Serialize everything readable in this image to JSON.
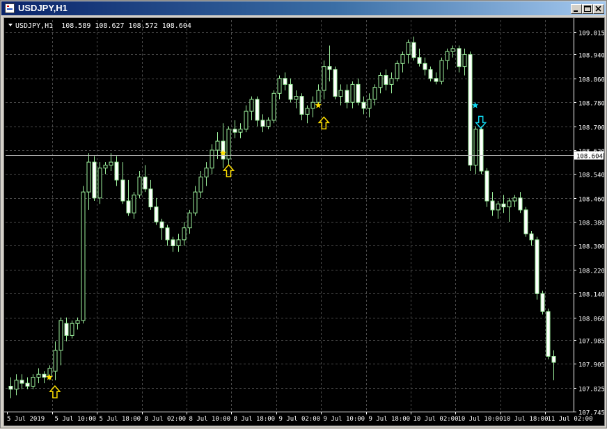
{
  "window": {
    "title": "USDJPY,H1",
    "controls": [
      "minimize",
      "maximize",
      "close"
    ]
  },
  "chart_header": {
    "symbol_period": "USDJPY,H1",
    "ohlc": "108.589 108.627 108.572 108.604"
  },
  "colors": {
    "background": "#000000",
    "grid": "#4a4a4a",
    "candle": "#9cf09c",
    "up_body": "#000000",
    "down_body": "#ffffff",
    "text": "#ffffff",
    "buy_signal": "#ffe000",
    "sell_signal": "#10d8f0",
    "price_line": "#c0c0c0"
  },
  "chart_data": {
    "type": "candlestick",
    "symbol": "USDJPY",
    "timeframe": "H1",
    "ylim": [
      107.745,
      109.055
    ],
    "y_ticks": [
      "109.015",
      "108.940",
      "108.860",
      "108.780",
      "108.700",
      "108.620",
      "108.540",
      "108.460",
      "108.380",
      "108.300",
      "108.220",
      "108.140",
      "108.060",
      "107.985",
      "107.905",
      "107.825",
      "107.745"
    ],
    "x_ticks": [
      "5 Jul 2019",
      "5 Jul 10:00",
      "5 Jul 18:00",
      "8 Jul 02:00",
      "8 Jul 10:00",
      "8 Jul 18:00",
      "9 Jul 02:00",
      "9 Jul 10:00",
      "9 Jul 18:00",
      "10 Jul 02:00",
      "10 Jul 10:00",
      "10 Jul 18:00",
      "11 Jul 02:00"
    ],
    "x_tick_slots": [
      0,
      8,
      16,
      24,
      32,
      40,
      48,
      56,
      64,
      72,
      80,
      88,
      96
    ],
    "current_price": "108.604",
    "grid": true,
    "candles": [
      [
        107.83,
        107.86,
        107.79,
        107.82
      ],
      [
        107.82,
        107.87,
        107.8,
        107.85
      ],
      [
        107.85,
        107.87,
        107.82,
        107.84
      ],
      [
        107.84,
        107.86,
        107.82,
        107.83
      ],
      [
        107.83,
        107.87,
        107.82,
        107.86
      ],
      [
        107.86,
        107.89,
        107.84,
        107.87
      ],
      [
        107.87,
        107.88,
        107.84,
        107.86
      ],
      [
        107.86,
        107.9,
        107.85,
        107.89
      ],
      [
        107.88,
        107.98,
        107.85,
        107.95
      ],
      [
        107.95,
        108.06,
        107.9,
        108.05
      ],
      [
        108.04,
        108.06,
        107.98,
        108.0
      ],
      [
        108.0,
        108.05,
        107.99,
        108.04
      ],
      [
        108.04,
        108.06,
        108.02,
        108.05
      ],
      [
        108.05,
        108.5,
        108.04,
        108.48
      ],
      [
        108.48,
        108.61,
        108.42,
        108.58
      ],
      [
        108.58,
        108.6,
        108.45,
        108.46
      ],
      [
        108.46,
        108.58,
        108.44,
        108.56
      ],
      [
        108.56,
        108.58,
        108.54,
        108.57
      ],
      [
        108.57,
        108.61,
        108.55,
        108.58
      ],
      [
        108.58,
        108.6,
        108.5,
        108.52
      ],
      [
        108.52,
        108.58,
        108.44,
        108.45
      ],
      [
        108.45,
        108.52,
        108.4,
        108.41
      ],
      [
        108.41,
        108.48,
        108.39,
        108.47
      ],
      [
        108.47,
        108.55,
        108.46,
        108.53
      ],
      [
        108.53,
        108.57,
        108.48,
        108.49
      ],
      [
        108.49,
        108.52,
        108.42,
        108.43
      ],
      [
        108.43,
        108.46,
        108.37,
        108.38
      ],
      [
        108.38,
        108.39,
        108.32,
        108.36
      ],
      [
        108.36,
        108.37,
        108.3,
        108.32
      ],
      [
        108.32,
        108.33,
        108.28,
        108.3
      ],
      [
        108.3,
        108.34,
        108.28,
        108.32
      ],
      [
        108.32,
        108.38,
        108.3,
        108.36
      ],
      [
        108.36,
        108.42,
        108.34,
        108.41
      ],
      [
        108.41,
        108.5,
        108.4,
        108.48
      ],
      [
        108.48,
        108.55,
        108.46,
        108.53
      ],
      [
        108.53,
        108.58,
        108.5,
        108.56
      ],
      [
        108.56,
        108.64,
        108.54,
        108.62
      ],
      [
        108.62,
        108.68,
        108.59,
        108.65
      ],
      [
        108.65,
        108.71,
        108.56,
        108.59
      ],
      [
        108.59,
        108.7,
        108.57,
        108.69
      ],
      [
        108.69,
        108.72,
        108.66,
        108.68
      ],
      [
        108.68,
        108.71,
        108.66,
        108.69
      ],
      [
        108.69,
        108.77,
        108.68,
        108.75
      ],
      [
        108.75,
        108.8,
        108.72,
        108.79
      ],
      [
        108.79,
        108.8,
        108.7,
        108.72
      ],
      [
        108.72,
        108.74,
        108.68,
        108.7
      ],
      [
        108.7,
        108.73,
        108.69,
        108.72
      ],
      [
        108.72,
        108.82,
        108.71,
        108.81
      ],
      [
        108.81,
        108.87,
        108.79,
        108.86
      ],
      [
        108.86,
        108.88,
        108.82,
        108.84
      ],
      [
        108.84,
        108.86,
        108.78,
        108.79
      ],
      [
        108.79,
        108.82,
        108.76,
        108.8
      ],
      [
        108.8,
        108.81,
        108.72,
        108.74
      ],
      [
        108.74,
        108.77,
        108.71,
        108.76
      ],
      [
        108.76,
        108.8,
        108.73,
        108.78
      ],
      [
        108.78,
        108.84,
        108.77,
        108.82
      ],
      [
        108.82,
        108.92,
        108.79,
        108.9
      ],
      [
        108.9,
        108.97,
        108.85,
        108.89
      ],
      [
        108.89,
        108.9,
        108.79,
        108.8
      ],
      [
        108.8,
        108.84,
        108.77,
        108.82
      ],
      [
        108.82,
        108.84,
        108.76,
        108.78
      ],
      [
        108.78,
        108.85,
        108.76,
        108.84
      ],
      [
        108.84,
        108.86,
        108.77,
        108.78
      ],
      [
        108.78,
        108.8,
        108.74,
        108.76
      ],
      [
        108.76,
        108.81,
        108.73,
        108.79
      ],
      [
        108.79,
        108.84,
        108.77,
        108.83
      ],
      [
        108.83,
        108.88,
        108.81,
        108.87
      ],
      [
        108.87,
        108.89,
        108.82,
        108.84
      ],
      [
        108.84,
        108.88,
        108.81,
        108.86
      ],
      [
        108.86,
        108.92,
        108.85,
        108.91
      ],
      [
        108.91,
        108.95,
        108.88,
        108.94
      ],
      [
        108.94,
        108.99,
        108.91,
        108.98
      ],
      [
        108.98,
        109.0,
        108.92,
        108.93
      ],
      [
        108.93,
        108.96,
        108.9,
        108.91
      ],
      [
        108.91,
        108.93,
        108.87,
        108.89
      ],
      [
        108.89,
        108.9,
        108.85,
        108.86
      ],
      [
        108.86,
        108.88,
        108.84,
        108.85
      ],
      [
        108.85,
        108.93,
        108.84,
        108.92
      ],
      [
        108.92,
        108.96,
        108.89,
        108.95
      ],
      [
        108.95,
        108.97,
        108.93,
        108.96
      ],
      [
        108.96,
        108.97,
        108.88,
        108.9
      ],
      [
        108.9,
        108.96,
        108.87,
        108.94
      ],
      [
        108.94,
        108.95,
        108.55,
        108.57
      ],
      [
        108.57,
        108.7,
        108.54,
        108.69
      ],
      [
        108.69,
        108.7,
        108.54,
        108.55
      ],
      [
        108.55,
        108.56,
        108.43,
        108.45
      ],
      [
        108.45,
        108.48,
        108.4,
        108.42
      ],
      [
        108.42,
        108.45,
        108.39,
        108.44
      ],
      [
        108.44,
        108.47,
        108.41,
        108.43
      ],
      [
        108.43,
        108.46,
        108.38,
        108.45
      ],
      [
        108.45,
        108.47,
        108.43,
        108.46
      ],
      [
        108.46,
        108.48,
        108.41,
        108.42
      ],
      [
        108.42,
        108.43,
        108.33,
        108.34
      ],
      [
        108.34,
        108.35,
        108.3,
        108.32
      ],
      [
        108.32,
        108.33,
        108.12,
        108.14
      ],
      [
        108.14,
        108.15,
        108.07,
        108.08
      ],
      [
        108.08,
        108.09,
        107.92,
        107.93
      ],
      [
        107.93,
        107.95,
        107.85,
        107.91
      ]
    ],
    "signals": [
      {
        "type": "buy-star",
        "slot": 7,
        "price": 107.86
      },
      {
        "type": "buy-arrow",
        "slot": 8,
        "price": 107.84
      },
      {
        "type": "buy-star",
        "slot": 38,
        "price": 108.61
      },
      {
        "type": "buy-arrow",
        "slot": 39,
        "price": 108.58
      },
      {
        "type": "buy-star",
        "slot": 55,
        "price": 108.77
      },
      {
        "type": "buy-arrow",
        "slot": 56,
        "price": 108.74
      },
      {
        "type": "sell-star",
        "slot": 83,
        "price": 108.77
      },
      {
        "type": "sell-arrow",
        "slot": 84,
        "price": 108.74
      }
    ]
  }
}
